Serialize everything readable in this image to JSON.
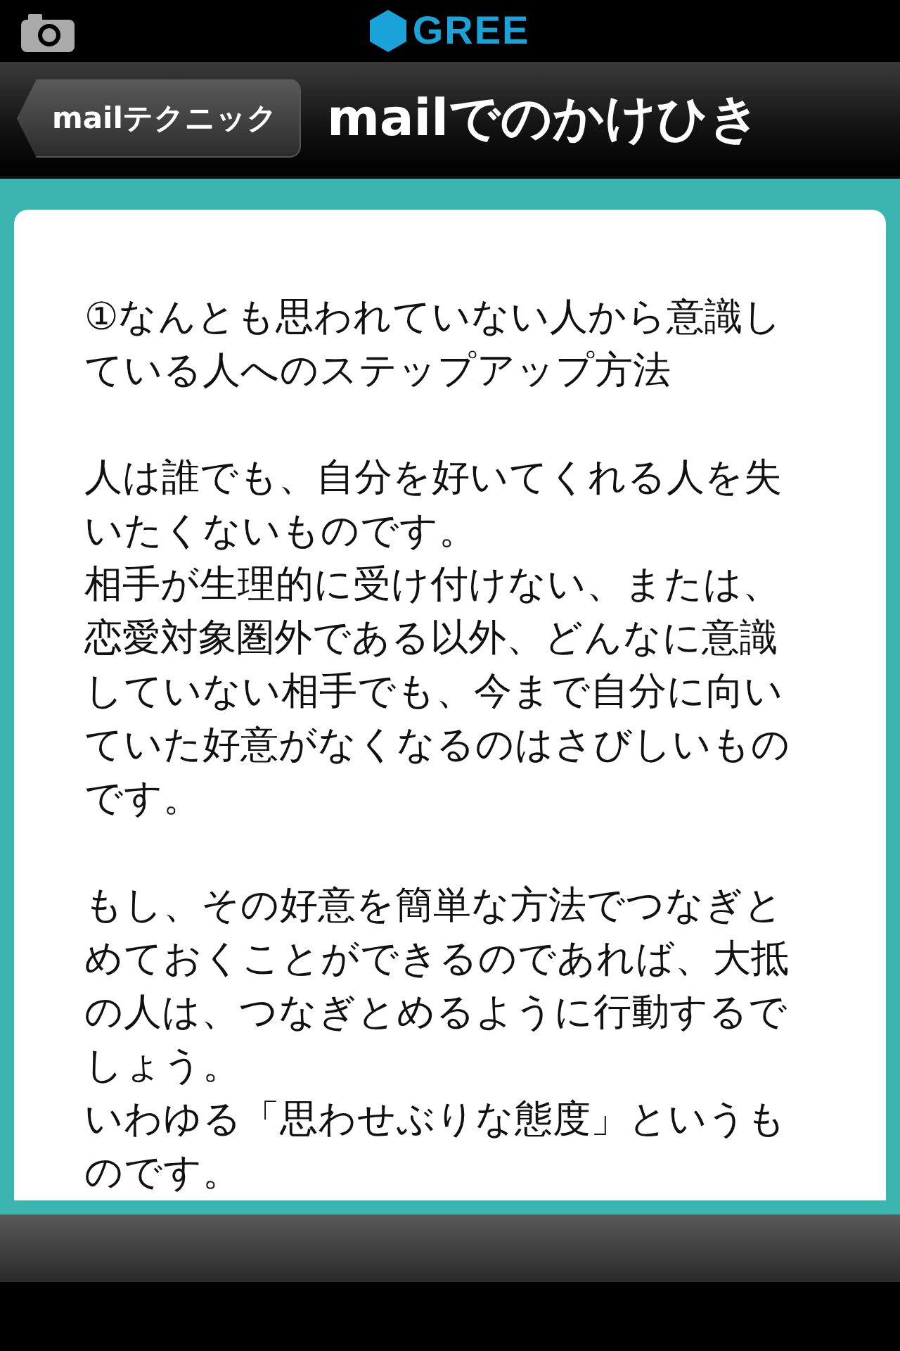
{
  "status_bar": {
    "logo_text": "GREE"
  },
  "nav_bar": {
    "back_button": "mailテクニック",
    "title": "mailでのかけひき"
  },
  "article": {
    "sections": [
      {
        "lines": [
          "①なんとも思われていない人から意識し",
          "ている人へのステップアップ方法"
        ]
      },
      {
        "lines": [
          "人は誰でも、自分を好いてくれる人を失",
          "いたくないものです。",
          "相手が生理的に受け付けない、または、",
          "恋愛対象圏外である以外、どんなに意識",
          "していない相手でも、今まで自分に向い",
          "ていた好意がなくなるのはさびしいもの",
          "です。"
        ]
      },
      {
        "lines": [
          "もし、その好意を簡単な方法でつなぎと",
          "めておくことができるのであれば、大抵",
          "の人は、つなぎとめるように行動するで",
          "しょう。",
          "いわゆる「思わせぶりな態度」というも",
          "のです。"
        ]
      }
    ]
  }
}
